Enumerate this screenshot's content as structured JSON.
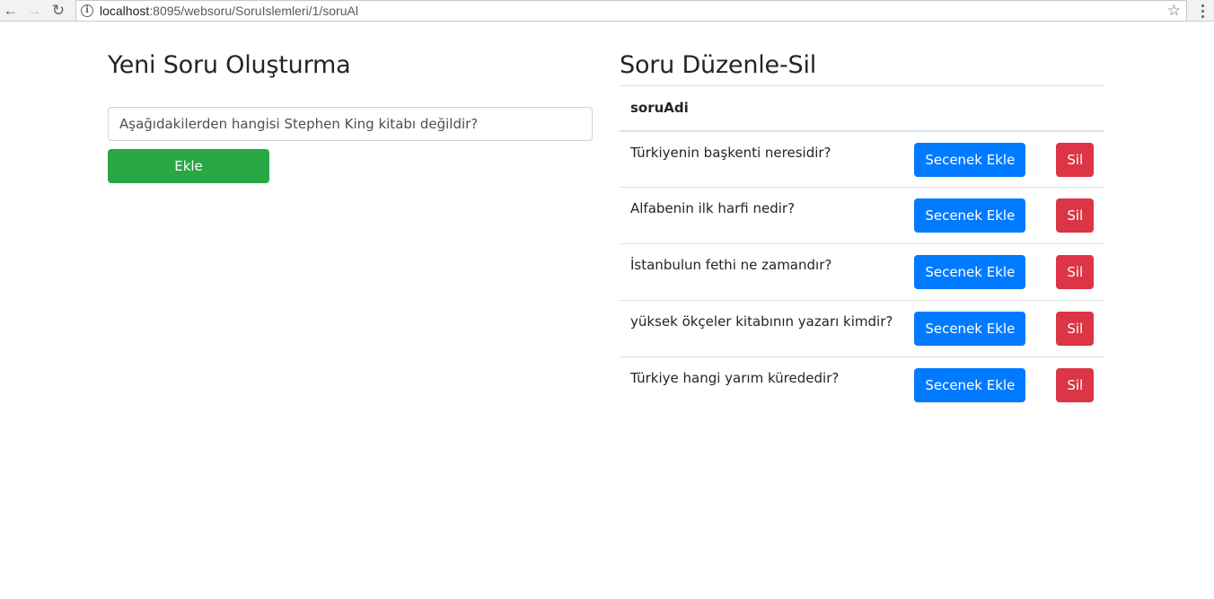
{
  "browser": {
    "url_host": "localhost",
    "url_rest": ":8095/websoru/SoruIslemleri/1/soruAl"
  },
  "left": {
    "title": "Yeni Soru Oluşturma",
    "input_value": "Aşağıdakilerden hangisi Stephen King kitabı değildir?",
    "add_label": "Ekle"
  },
  "right": {
    "title": "Soru Düzenle-Sil",
    "column_header": "soruAdi",
    "rows": [
      {
        "text": "Türkiyenin başkenti neresidir?",
        "option_label": "Secenek Ekle",
        "delete_label": "Sil"
      },
      {
        "text": "Alfabenin ilk harfi nedir?",
        "option_label": "Secenek Ekle",
        "delete_label": "Sil"
      },
      {
        "text": "İstanbulun fethi ne zamandır?",
        "option_label": "Secenek Ekle",
        "delete_label": "Sil"
      },
      {
        "text": "yüksek ökçeler kitabının yazarı kimdir?",
        "option_label": "Secenek Ekle",
        "delete_label": "Sil"
      },
      {
        "text": "Türkiye hangi yarım kürededir?",
        "option_label": "Secenek Ekle",
        "delete_label": "Sil"
      }
    ]
  },
  "colors": {
    "success": "#28a745",
    "primary": "#007bff",
    "danger": "#dc3545"
  }
}
